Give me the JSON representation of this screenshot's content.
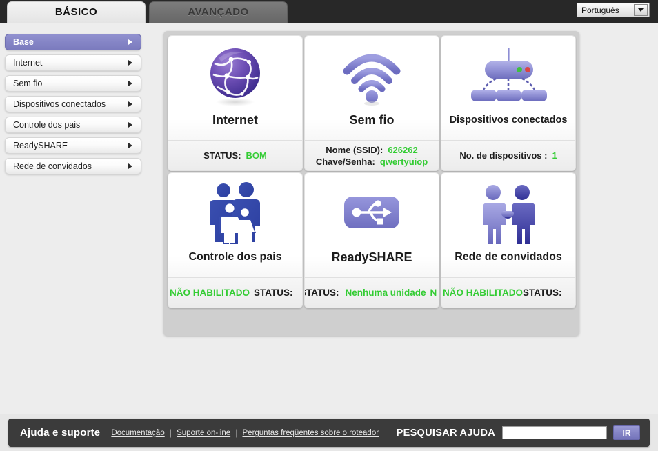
{
  "header": {
    "tabs": [
      {
        "label": "BÁSICO",
        "active": true
      },
      {
        "label": "AVANÇADO",
        "active": false
      }
    ],
    "language": {
      "value": "Português"
    }
  },
  "sidebar": {
    "items": [
      {
        "label": "Base",
        "active": true
      },
      {
        "label": "Internet",
        "active": false
      },
      {
        "label": "Sem fio",
        "active": false
      },
      {
        "label": "Dispositivos conectados",
        "active": false
      },
      {
        "label": "Controle dos pais",
        "active": false
      },
      {
        "label": "ReadySHARE",
        "active": false
      },
      {
        "label": "Rede de convidados",
        "active": false
      }
    ]
  },
  "cards": {
    "internet": {
      "title": "Internet",
      "icon": "globe-icon",
      "status_label": "STATUS:",
      "status_value": "BOM"
    },
    "wireless": {
      "title": "Sem fio",
      "icon": "wifi-icon",
      "ssid_label": "Nome (SSID):",
      "ssid_value": "626262",
      "key_label": "Chave/Senha:",
      "key_value": "qwertyuiop"
    },
    "attached_devices": {
      "title": "Dispositivos conectados",
      "icon": "router-devices-icon",
      "count_label": "No. de dispositivos :",
      "count_value": "1"
    },
    "parental_controls": {
      "title": "Controle dos pais",
      "icon": "family-icon",
      "status_value": "NÃO HABILITADO",
      "status_label": "STATUS:"
    },
    "readyshare": {
      "title": "ReadySHARE",
      "icon": "usb-icon",
      "status_label": "STATUS:",
      "status_value": "Nenhuma unidade",
      "status_value_overflow": "N"
    },
    "guest_network": {
      "title": "Rede de convidados",
      "icon": "handshake-icon",
      "status_value": "NÃO HABILITADO",
      "status_label": "STATUS:"
    }
  },
  "footer": {
    "title": "Ajuda e suporte",
    "links": [
      "Documentação",
      "Suporte on-line",
      "Perguntas freqüentes sobre o roteador"
    ],
    "separator": "|",
    "search_label": "PESQUISAR AJUDA",
    "search_value": "",
    "search_placeholder": "",
    "go_label": "IR"
  },
  "colors": {
    "accent_purple": "#8585c6",
    "status_green": "#33cc33",
    "bar_dark": "#3b3b3b"
  }
}
